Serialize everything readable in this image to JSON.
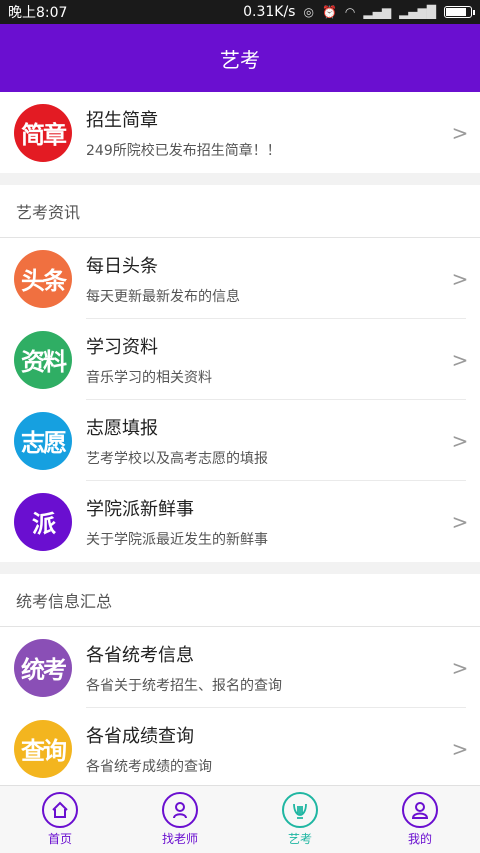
{
  "status_bar": {
    "time": "晚上8:07",
    "network_speed": "0.31K/s",
    "battery_level": 0.85
  },
  "header": {
    "title": "艺考"
  },
  "top_item": {
    "title": "招生简章",
    "subtitle": "249所院校已发布招生简章！！",
    "logo_text": "简章",
    "logo_color": "#e31b23"
  },
  "sections": [
    {
      "title": "艺考资讯",
      "items": [
        {
          "title": "每日头条",
          "subtitle": "每天更新最新发布的信息",
          "logo_text": "头条",
          "logo_color": "#f07040"
        },
        {
          "title": "学习资料",
          "subtitle": "音乐学习的相关资料",
          "logo_text": "资料",
          "logo_color": "#2fae64"
        },
        {
          "title": "志愿填报",
          "subtitle": "艺考学校以及高考志愿的填报",
          "logo_text": "志愿",
          "logo_color": "#16a0e0"
        },
        {
          "title": "学院派新鲜事",
          "subtitle": "关于学院派最近发生的新鲜事",
          "logo_text": "派",
          "logo_color": "#6a0fd0"
        }
      ]
    },
    {
      "title": "统考信息汇总",
      "items": [
        {
          "title": "各省统考信息",
          "subtitle": "各省关于统考招生、报名的查询",
          "logo_text": "统考",
          "logo_color": "#8a4fb6"
        },
        {
          "title": "各省成绩查询",
          "subtitle": "各省统考成绩的查询",
          "logo_text": "查询",
          "logo_color": "#f3b51f"
        }
      ]
    }
  ],
  "chevron": ">",
  "tabs": [
    {
      "label": "首页",
      "icon": "home-icon"
    },
    {
      "label": "找老师",
      "icon": "teacher-icon"
    },
    {
      "label": "艺考",
      "icon": "lyre-icon",
      "active": true
    },
    {
      "label": "我的",
      "icon": "profile-icon"
    }
  ],
  "colors": {
    "brand": "#6a0fd0",
    "active_tab": "#1fb6a2"
  }
}
